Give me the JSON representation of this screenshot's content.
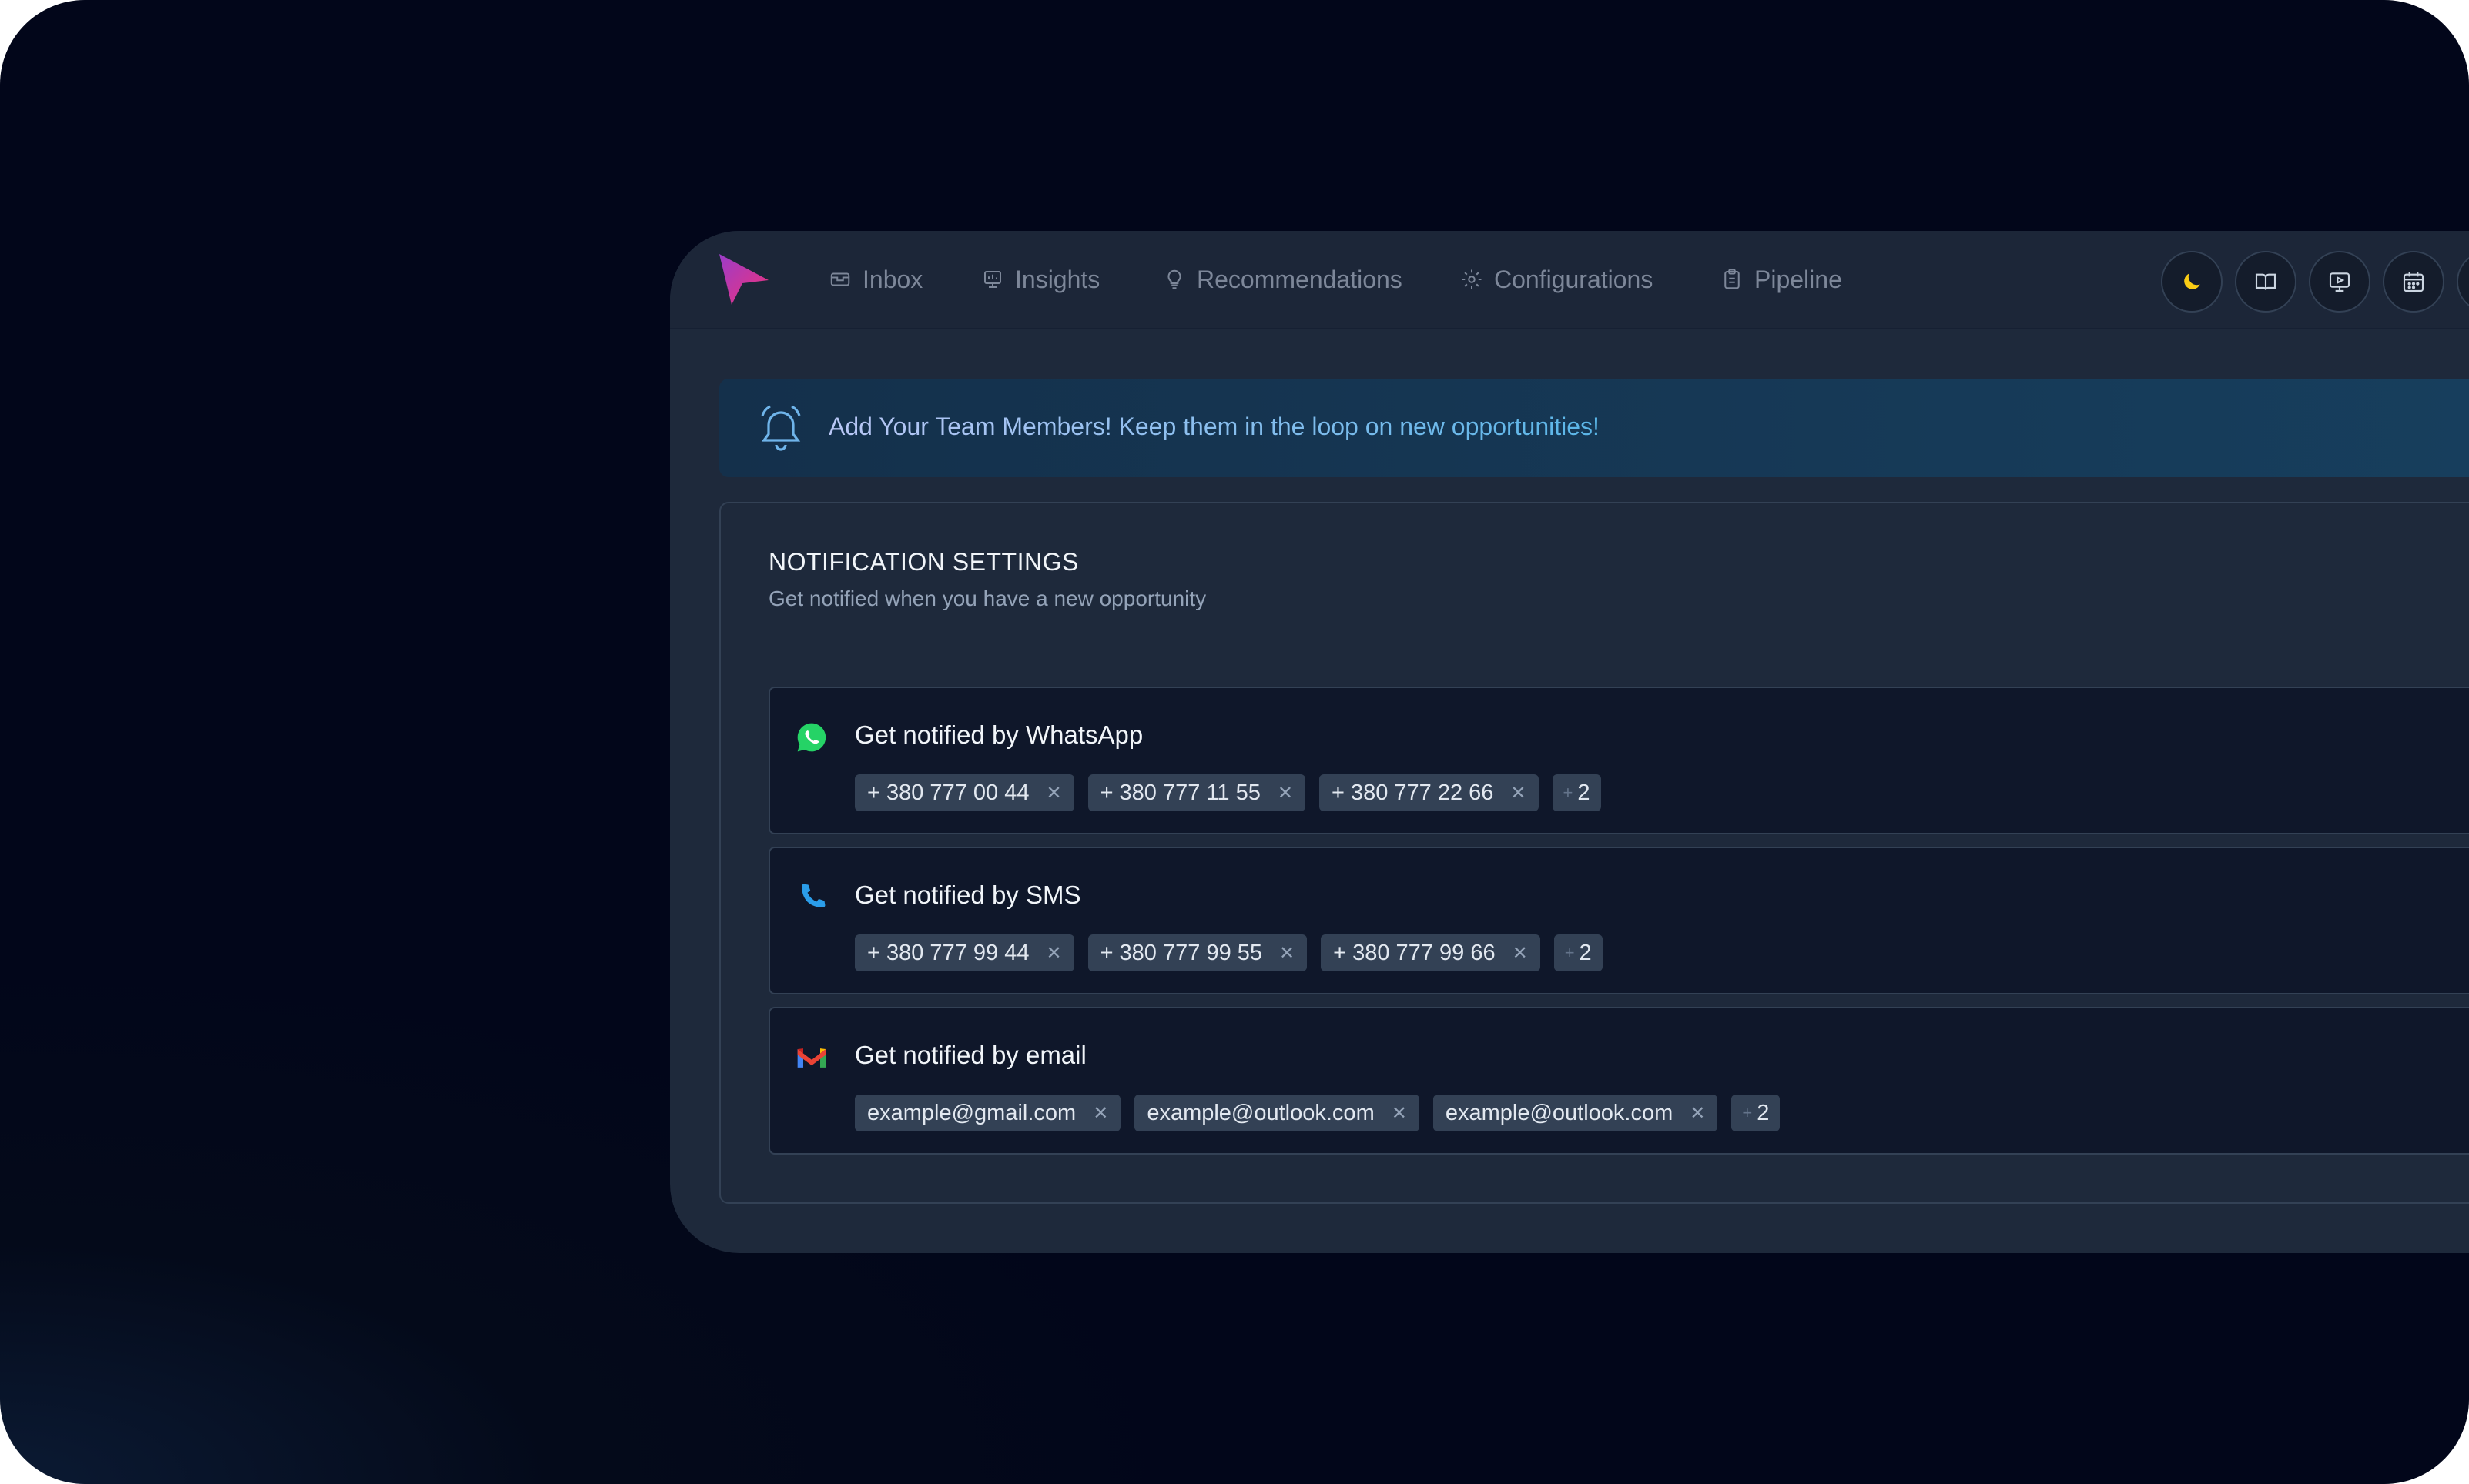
{
  "nav": {
    "items": [
      {
        "label": "Inbox",
        "icon": "inbox-icon"
      },
      {
        "label": "Insights",
        "icon": "insights-icon"
      },
      {
        "label": "Recommendations",
        "icon": "lightbulb-icon"
      },
      {
        "label": "Configurations",
        "icon": "gear-icon"
      },
      {
        "label": "Pipeline",
        "icon": "clipboard-icon"
      }
    ],
    "buttons": [
      "moon-icon",
      "book-icon",
      "video-icon",
      "calendar-icon"
    ]
  },
  "banner": {
    "text": "Add Your Team Members! Keep them in the loop on new opportunities!"
  },
  "settings": {
    "title": "NOTIFICATION SETTINGS",
    "subtitle": "Get notified when you have a new opportunity",
    "channels": [
      {
        "label": "Get notified by WhatsApp",
        "icon": "whatsapp-icon",
        "chips": [
          "+ 380 777 00 44",
          "+ 380 777 11 55",
          "+ 380 777 22 66"
        ],
        "more": "2"
      },
      {
        "label": "Get notified by SMS",
        "icon": "phone-icon",
        "chips": [
          "+ 380 777 99 44",
          "+ 380 777 99 55",
          "+ 380 777 99 66"
        ],
        "more": "2"
      },
      {
        "label": "Get notified by email",
        "icon": "gmail-icon",
        "chips": [
          "example@gmail.com",
          "example@outlook.com",
          "example@outlook.com"
        ],
        "more": "2"
      }
    ]
  },
  "colors": {
    "background": "#030818",
    "panel": "#1e293b",
    "card": "#0f172a",
    "chip": "#334155",
    "accent": "#e0307a",
    "moon": "#facc15"
  }
}
